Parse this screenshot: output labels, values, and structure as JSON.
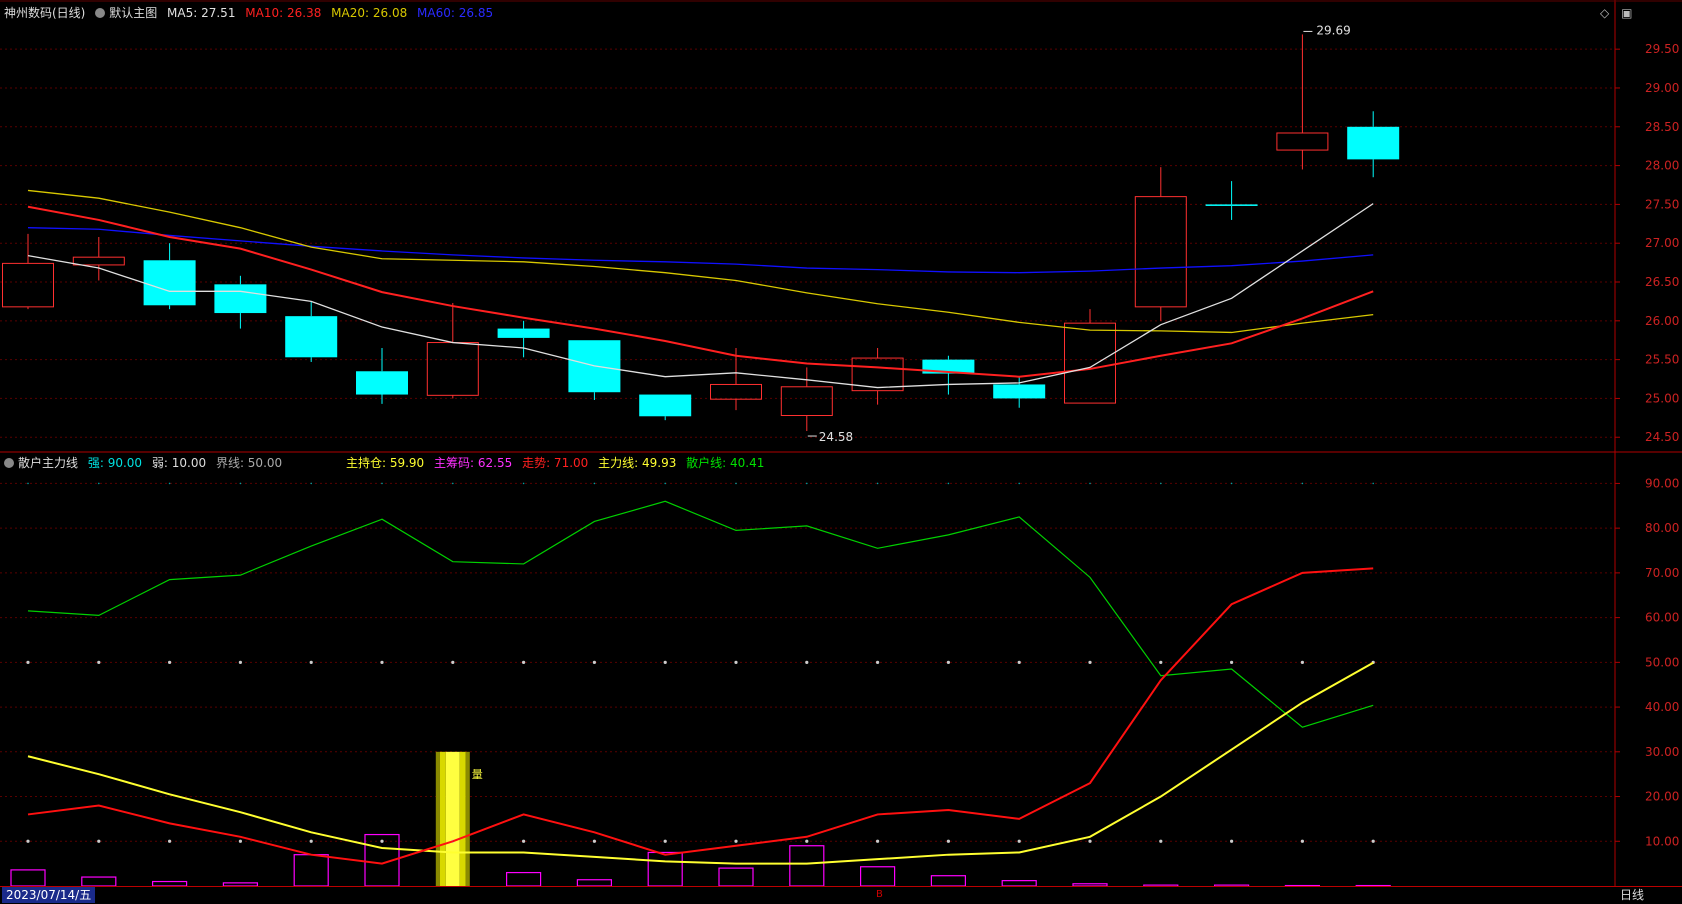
{
  "colors": {
    "bg": "#000000",
    "grid": "#5a0000",
    "axis_text": "#cc2222",
    "up": "#ff3030",
    "down": "#00ffff",
    "ma5": "#e0e0e0",
    "ma10": "#ff2020",
    "ma20": "#d8c800",
    "ma60": "#1010ff",
    "retail": "#00d000",
    "main": "#ffff30",
    "trend": "#ff1010",
    "chips": "#ff00ff"
  },
  "top_legend": {
    "title": "神州数码(日线)",
    "chart_name": "默认主图",
    "ma5": "MA5: 27.51",
    "ma10": "MA10: 26.38",
    "ma20": "MA20: 26.08",
    "ma60": "MA60: 26.85"
  },
  "bottom_legend": {
    "title": "散户主力线",
    "strong": "强: 90.00",
    "weak": "弱: 10.00",
    "boundary": "界线: 50.00",
    "main_hold": "主持仓: 59.90",
    "main_chips": "主筹码: 62.55",
    "trend": "走势: 71.00",
    "main_line": "主力线: 49.93",
    "retail_line": "散户线: 40.41"
  },
  "toolbar": {
    "diamond": "◇",
    "box": "▣"
  },
  "status": {
    "date": "2023/07/14/五",
    "period": "日线",
    "mid_mark": "B"
  },
  "chart_data": [
    {
      "type": "candlestick",
      "yticks": [
        "29.50",
        "29.00",
        "28.50",
        "28.00",
        "27.50",
        "27.00",
        "26.50",
        "26.00",
        "25.50",
        "25.00",
        "24.50"
      ],
      "ylim": [
        24.4,
        29.85
      ],
      "candles": [
        {
          "o": 26.18,
          "h": 27.12,
          "l": 26.15,
          "c": 26.74
        },
        {
          "o": 26.72,
          "h": 27.08,
          "l": 26.52,
          "c": 26.82
        },
        {
          "o": 26.78,
          "h": 27.0,
          "l": 26.15,
          "c": 26.2
        },
        {
          "o": 26.47,
          "h": 26.58,
          "l": 25.9,
          "c": 26.1
        },
        {
          "o": 26.06,
          "h": 26.25,
          "l": 25.47,
          "c": 25.53
        },
        {
          "o": 25.35,
          "h": 25.65,
          "l": 24.93,
          "c": 25.05
        },
        {
          "o": 25.04,
          "h": 26.23,
          "l": 25.0,
          "c": 25.72
        },
        {
          "o": 25.9,
          "h": 26.0,
          "l": 25.53,
          "c": 25.78
        },
        {
          "o": 25.75,
          "h": 25.75,
          "l": 24.98,
          "c": 25.08
        },
        {
          "o": 25.05,
          "h": 25.05,
          "l": 24.72,
          "c": 24.77
        },
        {
          "o": 24.99,
          "h": 25.65,
          "l": 24.85,
          "c": 25.18
        },
        {
          "o": 24.78,
          "h": 25.4,
          "l": 24.58,
          "c": 25.15
        },
        {
          "o": 25.1,
          "h": 25.65,
          "l": 24.92,
          "c": 25.52
        },
        {
          "o": 25.5,
          "h": 25.55,
          "l": 25.05,
          "c": 25.32
        },
        {
          "o": 25.18,
          "h": 25.28,
          "l": 24.88,
          "c": 25.0
        },
        {
          "o": 24.94,
          "h": 26.15,
          "l": 24.94,
          "c": 25.97
        },
        {
          "o": 26.18,
          "h": 27.98,
          "l": 26.0,
          "c": 27.6
        },
        {
          "o": 27.5,
          "h": 27.8,
          "l": 27.3,
          "c": 27.48
        },
        {
          "o": 28.2,
          "h": 29.69,
          "l": 27.95,
          "c": 28.42
        },
        {
          "o": 28.5,
          "h": 28.7,
          "l": 27.85,
          "c": 28.08
        }
      ],
      "ma5": [
        26.84,
        26.68,
        26.38,
        26.38,
        26.25,
        25.92,
        25.72,
        25.65,
        25.42,
        25.28,
        25.33,
        25.24,
        25.14,
        25.18,
        25.2,
        25.4,
        25.95,
        26.29,
        26.9,
        27.51
      ],
      "ma10": [
        27.47,
        27.3,
        27.08,
        26.93,
        26.66,
        26.37,
        26.19,
        26.04,
        25.9,
        25.74,
        25.55,
        25.45,
        25.4,
        25.34,
        25.28,
        25.38,
        25.55,
        25.71,
        26.03,
        26.38
      ],
      "ma20": [
        27.68,
        27.58,
        27.4,
        27.2,
        26.95,
        26.8,
        26.78,
        26.76,
        26.7,
        26.62,
        26.52,
        26.36,
        26.22,
        26.11,
        25.98,
        25.88,
        25.87,
        25.85,
        25.97,
        26.08
      ],
      "ma60": [
        27.2,
        27.18,
        27.1,
        27.03,
        26.96,
        26.9,
        26.85,
        26.81,
        26.78,
        26.76,
        26.73,
        26.68,
        26.66,
        26.63,
        26.62,
        26.64,
        26.68,
        26.71,
        26.77,
        26.85
      ],
      "annotations": [
        {
          "text": "29.69",
          "index": 18,
          "value": 29.69
        },
        {
          "text": "24.58",
          "index": 11,
          "value": 24.58
        }
      ]
    },
    {
      "type": "line",
      "yticks": [
        "90.00",
        "80.00",
        "70.00",
        "60.00",
        "50.00",
        "40.00",
        "30.00",
        "20.00",
        "10.00"
      ],
      "ylim": [
        0,
        93
      ],
      "series": [
        {
          "name": "散户线",
          "values": [
            61.5,
            60.5,
            68.5,
            69.5,
            76,
            82,
            72.5,
            72,
            81.5,
            86,
            79.5,
            80.5,
            75.5,
            78.5,
            82.5,
            69,
            47,
            48.5,
            35.5,
            40.4
          ]
        },
        {
          "name": "主力线",
          "values": [
            29,
            25,
            20.5,
            16.5,
            12,
            8.5,
            7.5,
            7.5,
            6.5,
            5.5,
            5,
            5,
            6,
            7,
            7.5,
            11,
            20,
            30.5,
            41,
            49.9
          ]
        },
        {
          "name": "走势",
          "values": [
            16,
            18,
            14,
            11,
            7,
            5,
            10,
            16,
            12,
            7,
            9,
            11,
            16,
            17,
            15,
            23,
            46,
            63,
            70,
            71
          ]
        }
      ],
      "chips_bars": [
        3.6,
        2.0,
        1.0,
        0.7,
        7.0,
        11.5,
        0,
        3.0,
        1.4,
        7.5,
        4.0,
        9.0,
        4.3,
        2.3,
        1.2,
        0.5,
        0.2,
        0.2,
        0.1,
        0.1
      ],
      "highlight_index": 6,
      "highlight_range": [
        0,
        30
      ],
      "highlight_label": "量",
      "strong": 90,
      "weak": 10,
      "boundary": 50
    }
  ]
}
